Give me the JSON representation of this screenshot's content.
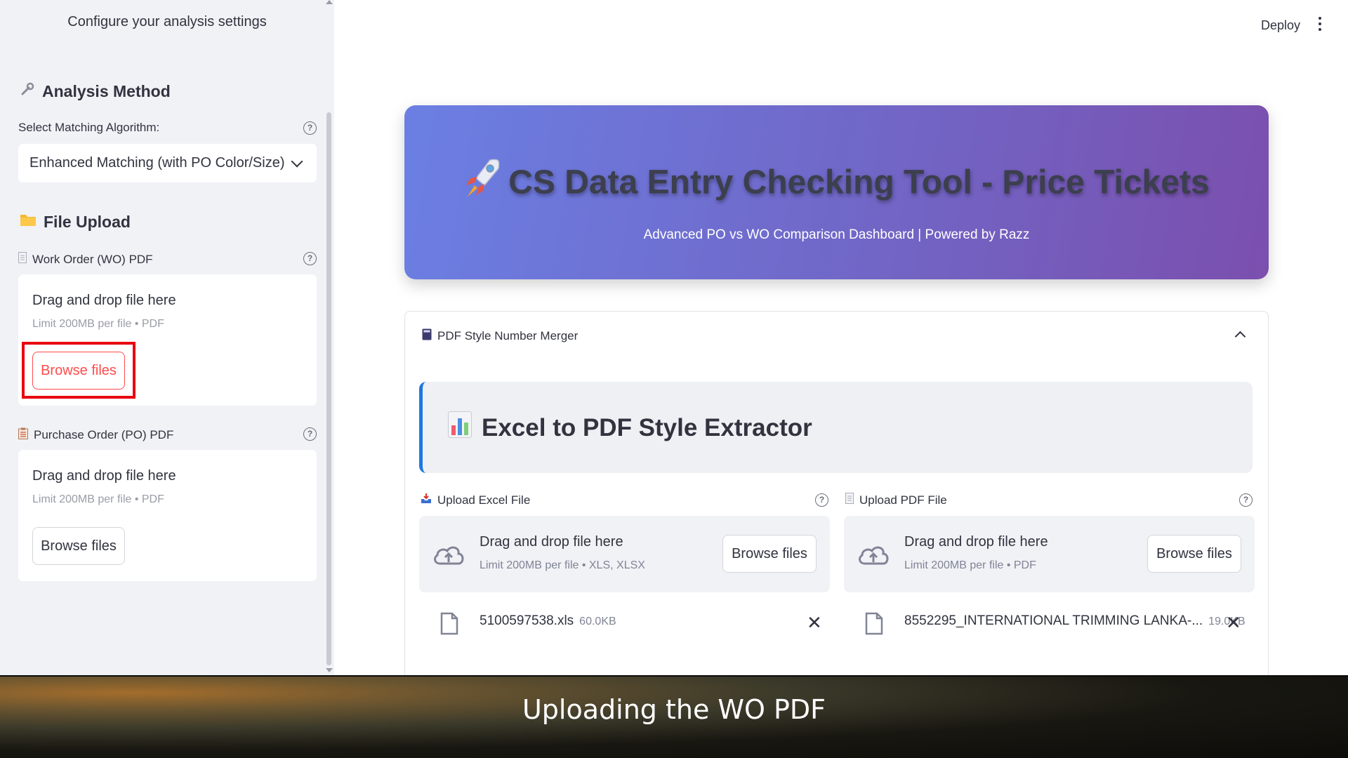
{
  "sidebar": {
    "subtitle": "Configure your analysis settings",
    "analysis_method": {
      "icon": "wrench-icon",
      "title": "Analysis Method"
    },
    "algorithm": {
      "label": "Select Matching Algorithm:",
      "selected": "Enhanced Matching (with PO Color/Size)"
    },
    "file_upload": {
      "icon": "folder-icon",
      "title": "File Upload"
    },
    "wo_upload": {
      "label": "Work Order (WO) PDF",
      "drop_text": "Drag and drop file here",
      "limit": "Limit 200MB per file • PDF",
      "button": "Browse files"
    },
    "po_upload": {
      "label": "Purchase Order (PO) PDF",
      "drop_text": "Drag and drop file here",
      "limit": "Limit 200MB per file • PDF",
      "button": "Browse files"
    }
  },
  "toolbar": {
    "deploy": "Deploy"
  },
  "hero": {
    "title": "CS Data Entry Checking Tool - Price Tickets",
    "subtitle": "Advanced PO vs WO Comparison Dashboard | Powered by Razz"
  },
  "expander": {
    "title": "PDF Style Number Merger",
    "banner_title": "Excel to PDF Style Extractor",
    "excel_upload": {
      "label": "Upload Excel File",
      "drop_text": "Drag and drop file here",
      "limit": "Limit 200MB per file • XLS, XLSX",
      "button": "Browse files",
      "file_name": "5100597538.xls",
      "file_size": "60.0KB"
    },
    "pdf_upload": {
      "label": "Upload PDF File",
      "drop_text": "Drag and drop file here",
      "limit": "Limit 200MB per file • PDF",
      "button": "Browse files",
      "file_name": "8552295_INTERNATIONAL TRIMMING LANKA-...",
      "file_size": "19.0KB"
    }
  },
  "caption": "Uploading the WO PDF",
  "colors": {
    "sidebar_bg": "#f0f2f6",
    "accent_red": "#ff4b4b",
    "highlight_box": "#e8000f",
    "banner_border": "#1f77e0",
    "hero_gradient_start": "#6b7fe3",
    "hero_gradient_end": "#7b4fae"
  }
}
